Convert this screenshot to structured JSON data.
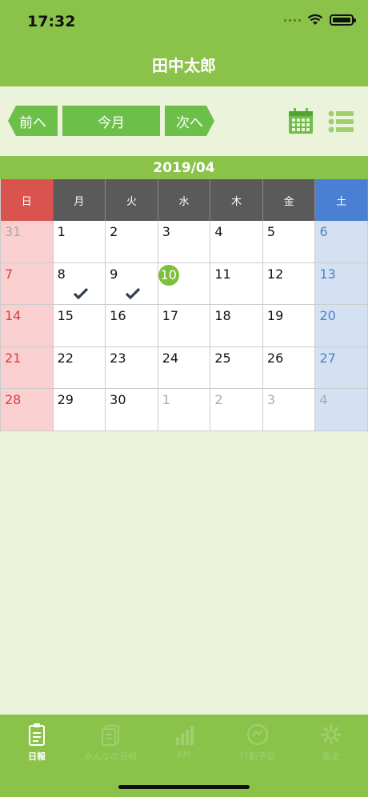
{
  "status": {
    "time": "17:32"
  },
  "header": {
    "title": "田中太郎"
  },
  "nav": {
    "prev": "前へ",
    "today": "今月",
    "next": "次へ"
  },
  "month": "2019/04",
  "weekdays": [
    "日",
    "月",
    "火",
    "水",
    "木",
    "金",
    "土"
  ],
  "weeks": [
    [
      "31",
      "1",
      "2",
      "3",
      "4",
      "5",
      "6"
    ],
    [
      "7",
      "8",
      "9",
      "10",
      "11",
      "12",
      "13"
    ],
    [
      "14",
      "15",
      "16",
      "17",
      "18",
      "19",
      "20"
    ],
    [
      "21",
      "22",
      "23",
      "24",
      "25",
      "26",
      "27"
    ],
    [
      "28",
      "29",
      "30",
      "1",
      "2",
      "3",
      "4"
    ]
  ],
  "outside_month_cells": [
    [
      0,
      0
    ],
    [
      4,
      3
    ],
    [
      4,
      4
    ],
    [
      4,
      5
    ],
    [
      4,
      6
    ]
  ],
  "today_cell": [
    1,
    3
  ],
  "checked_cells": [
    [
      1,
      1
    ],
    [
      1,
      2
    ]
  ],
  "tabs": [
    {
      "label": "日報",
      "icon": "clipboard-icon"
    },
    {
      "label": "みんなの日報",
      "icon": "reports-stack-icon"
    },
    {
      "label": "KPI",
      "icon": "bar-chart-icon"
    },
    {
      "label": "行動予定",
      "icon": "plan-circle-icon"
    },
    {
      "label": "設定",
      "icon": "gear-icon"
    }
  ],
  "colors": {
    "header": "#8bc34a",
    "button": "#6cc04a",
    "sunday": "#d9534f",
    "saturday": "#4a7fd4",
    "today": "#7cbf3c"
  }
}
